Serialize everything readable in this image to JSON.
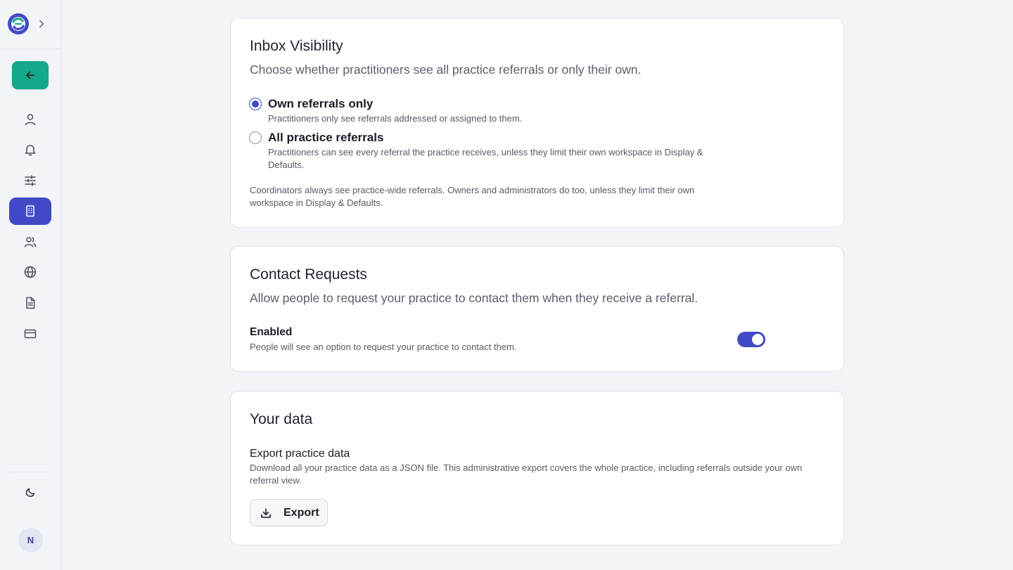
{
  "sidebar": {
    "avatar_initial": "N",
    "nav": [
      {
        "icon": "user-icon"
      },
      {
        "icon": "bell-icon"
      },
      {
        "icon": "sliders-icon"
      },
      {
        "icon": "building-icon",
        "active": true
      },
      {
        "icon": "users-icon"
      },
      {
        "icon": "globe-icon"
      },
      {
        "icon": "document-icon"
      },
      {
        "icon": "credit-card-icon"
      }
    ]
  },
  "inbox": {
    "title": "Inbox Visibility",
    "description": "Choose whether practitioners see all practice referrals or only their own.",
    "options": [
      {
        "label": "Own referrals only",
        "help": "Practitioners only see referrals addressed or assigned to them.",
        "checked": true
      },
      {
        "label": "All practice referrals",
        "help": "Practitioners can see every referral the practice receives, unless they limit their own workspace in Display & Defaults.",
        "checked": false
      }
    ],
    "note": "Coordinators always see practice-wide referrals. Owners and administrators do too, unless they limit their own workspace in Display & Defaults."
  },
  "contact": {
    "title": "Contact Requests",
    "description": "Allow people to request your practice to contact them when they receive a referral.",
    "setting_label": "Enabled",
    "setting_help": "People will see an option to request your practice to contact them.",
    "enabled": true
  },
  "data": {
    "title": "Your data",
    "export_label": "Export practice data",
    "export_help": "Download all your practice data as a JSON file. This administrative export covers the whole practice, including referrals outside your own referral view.",
    "export_button": "Export"
  },
  "colors": {
    "accent": "#4149c7",
    "back_button": "#13a88a"
  }
}
